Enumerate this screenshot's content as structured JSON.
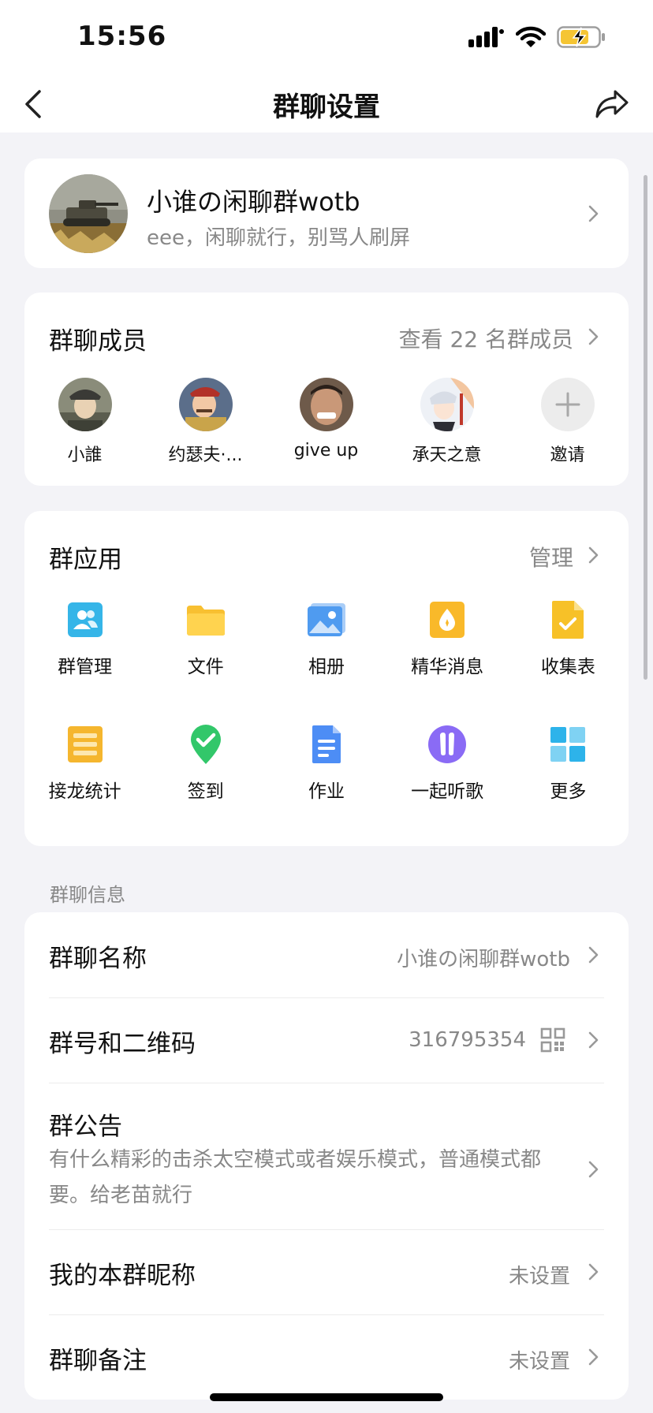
{
  "status": {
    "time": "15:56"
  },
  "nav": {
    "title": "群聊设置"
  },
  "group": {
    "name": "小谁の闲聊群wotb",
    "description": "eee，闲聊就行，别骂人刷屏"
  },
  "members": {
    "title": "群聊成员",
    "view_all": "查看 22 名群成员",
    "list": [
      {
        "name": "小誰"
      },
      {
        "name": "约瑟夫·..."
      },
      {
        "name": "give up"
      },
      {
        "name": "承天之意"
      },
      {
        "name": "邀请"
      }
    ]
  },
  "apps": {
    "title": "群应用",
    "manage": "管理",
    "items": [
      {
        "label": "群管理",
        "icon": "group-manage-icon",
        "color": "#35b5e8"
      },
      {
        "label": "文件",
        "icon": "folder-icon",
        "color": "#f8c031"
      },
      {
        "label": "相册",
        "icon": "album-icon",
        "color": "#4f9bf0"
      },
      {
        "label": "精华消息",
        "icon": "essence-icon",
        "color": "#f9b92a"
      },
      {
        "label": "收集表",
        "icon": "form-icon",
        "color": "#f7c128"
      },
      {
        "label": "接龙统计",
        "icon": "relay-icon",
        "color": "#f5b62e"
      },
      {
        "label": "签到",
        "icon": "checkin-icon",
        "color": "#32c76a"
      },
      {
        "label": "作业",
        "icon": "homework-icon",
        "color": "#4d8df5"
      },
      {
        "label": "一起听歌",
        "icon": "music-icon",
        "color": "#8a6bf5"
      },
      {
        "label": "更多",
        "icon": "more-grid-icon",
        "color": "#2db3ea"
      }
    ]
  },
  "info": {
    "section_label": "群聊信息",
    "name_title": "群聊名称",
    "name_value": "小谁の闲聊群wotb",
    "id_title": "群号和二维码",
    "id_value": "316795354",
    "notice_title": "群公告",
    "notice_text": "有什么精彩的击杀太空模式或者娱乐模式，普通模式都要。给老苗就行",
    "nickname_title": "我的本群昵称",
    "nickname_value": "未设置",
    "remark_title": "群聊备注",
    "remark_value": "未设置"
  }
}
